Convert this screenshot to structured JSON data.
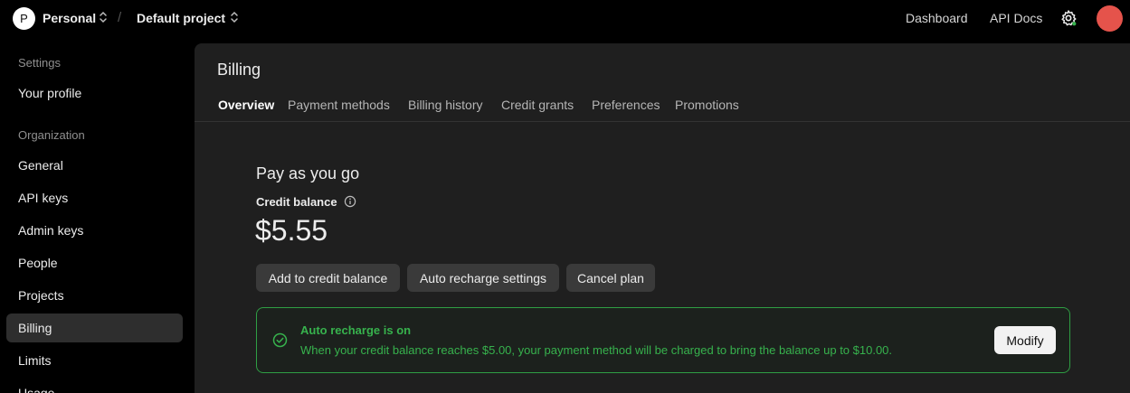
{
  "topbar": {
    "org_initial": "P",
    "org_name": "Personal",
    "separator": "/",
    "project_name": "Default project",
    "links": [
      "Dashboard",
      "API Docs"
    ]
  },
  "sidebar": {
    "settings_heading": "Settings",
    "your_profile": "Your profile",
    "org_heading": "Organization",
    "items": [
      "General",
      "API keys",
      "Admin keys",
      "People",
      "Projects",
      "Billing",
      "Limits",
      "Usage"
    ]
  },
  "main": {
    "title": "Billing",
    "tabs": [
      "Overview",
      "Payment methods",
      "Billing history",
      "Credit grants",
      "Preferences",
      "Promotions"
    ],
    "plan_title": "Pay as you go",
    "balance_label": "Credit balance",
    "balance_value": "$5.55",
    "buttons": [
      "Add to credit balance",
      "Auto recharge settings",
      "Cancel plan"
    ],
    "notice": {
      "title": "Auto recharge is on",
      "body": "When your credit balance reaches $5.00, your payment method will be charged to bring the balance up to $10.00.",
      "button": "Modify"
    }
  },
  "colors": {
    "accent_green": "#37b24d",
    "avatar_red": "#e5534b"
  },
  "icons": [
    "chevron-updown-icon",
    "gear-icon",
    "info-icon",
    "check-circle-icon"
  ]
}
